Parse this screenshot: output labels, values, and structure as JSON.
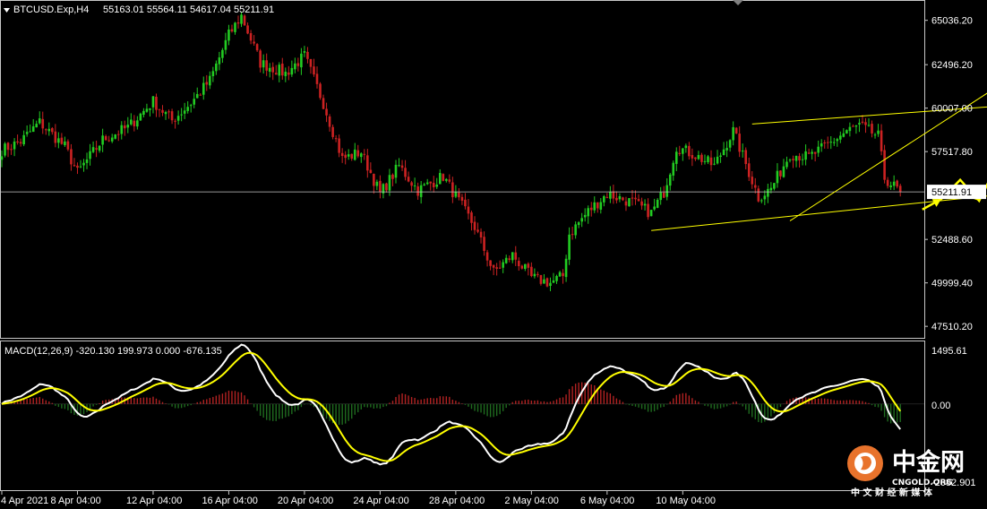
{
  "symbol_header": {
    "symbol": "BTCUSD.Exp,H4",
    "ohlc": "55163.01 55564.11 54617.04 55211.91"
  },
  "price_axis": {
    "ticks": [
      "65036.20",
      "62496.20",
      "60007.00",
      "57517.80",
      "55211.91",
      "52488.60",
      "49999.40",
      "47510.20"
    ],
    "current_price": "55211.91"
  },
  "macd_panel": {
    "label": "MACD(12,26,9) -320.130 199.973 0.000 -676.135",
    "ticks": [
      "1495.61",
      "0.00",
      "-2082.901"
    ]
  },
  "time_axis": {
    "ticks": [
      "4 Apr 2021",
      "8 Apr 04:00",
      "12 Apr 04:00",
      "16 Apr 04:00",
      "20 Apr 04:00",
      "24 Apr 04:00",
      "28 Apr 04:00",
      "2 May 04:00",
      "6 May 04:00",
      "10 May 04:00"
    ]
  },
  "watermark": {
    "brand_cn": "中金网",
    "brand_en": "CNGOLD.ORG",
    "tagline_cn": "中 文 财 经 新 媒 体"
  },
  "colors": {
    "background": "#000000",
    "bull_candle": "#22cc22",
    "bear_candle": "#cc2222",
    "macd_line": "#ffffff",
    "signal_line": "#ffff00",
    "hist_pos": "#b22222",
    "hist_neg": "#1f6b1f",
    "trendline": "#ffff00",
    "grid": "#c8c8c8"
  },
  "chart_data": [
    {
      "type": "candlestick",
      "title": "BTCUSD.Exp,H4",
      "ylim": [
        46800,
        66200
      ],
      "x_ticks": [
        "4 Apr 2021",
        "8 Apr 04:00",
        "12 Apr 04:00",
        "16 Apr 04:00",
        "20 Apr 04:00",
        "24 Apr 04:00",
        "28 Apr 04:00",
        "2 May 04:00",
        "6 May 04:00",
        "10 May 04:00"
      ],
      "anchors": {
        "bars_per_day": 6,
        "days": 38,
        "path": [
          [
            0,
            57600
          ],
          [
            6,
            58100
          ],
          [
            12,
            59200
          ],
          [
            20,
            57800
          ],
          [
            24,
            56300
          ],
          [
            32,
            58200
          ],
          [
            40,
            58900
          ],
          [
            48,
            60400
          ],
          [
            54,
            59300
          ],
          [
            60,
            60300
          ],
          [
            66,
            61600
          ],
          [
            72,
            64200
          ],
          [
            76,
            65300
          ],
          [
            82,
            62600
          ],
          [
            90,
            62000
          ],
          [
            96,
            63000
          ],
          [
            102,
            60300
          ],
          [
            108,
            57100
          ],
          [
            114,
            57500
          ],
          [
            120,
            55100
          ],
          [
            126,
            56700
          ],
          [
            132,
            55300
          ],
          [
            140,
            56100
          ],
          [
            150,
            53200
          ],
          [
            156,
            50600
          ],
          [
            162,
            51600
          ],
          [
            168,
            50300
          ],
          [
            174,
            50000
          ],
          [
            178,
            50400
          ],
          [
            180,
            52800
          ],
          [
            186,
            54100
          ],
          [
            192,
            55100
          ],
          [
            200,
            54600
          ],
          [
            206,
            54000
          ],
          [
            210,
            55200
          ],
          [
            214,
            57800
          ],
          [
            220,
            57300
          ],
          [
            226,
            56700
          ],
          [
            232,
            58700
          ],
          [
            236,
            56800
          ],
          [
            240,
            54900
          ],
          [
            244,
            55400
          ],
          [
            250,
            57400
          ],
          [
            256,
            57200
          ],
          [
            262,
            57900
          ],
          [
            268,
            58700
          ],
          [
            272,
            59000
          ],
          [
            278,
            58400
          ],
          [
            280,
            56000
          ],
          [
            285,
            55211.91
          ]
        ]
      },
      "trendlines": [
        {
          "name": "upper-channel",
          "from": [
            [
              238,
              59100
            ]
          ],
          "to": [
            [
              330,
              60300
            ]
          ]
        },
        {
          "name": "lower-channel",
          "from": [
            [
              206,
              53000
            ]
          ],
          "to": [
            [
              330,
              55300
            ]
          ]
        },
        {
          "name": "rising-line",
          "from": [
            [
              250,
              53550
            ]
          ],
          "to": [
            [
              330,
              62900
            ]
          ]
        }
      ],
      "projection": [
        [
          292,
          54200
        ],
        [
          298,
          54800
        ],
        [
          304,
          55900
        ],
        [
          308,
          55100
        ],
        [
          310,
          54700
        ],
        [
          318,
          57600
        ]
      ],
      "current_price": 55211.91
    },
    {
      "type": "macd",
      "params": [
        12,
        26,
        9
      ],
      "values": {
        "macd": -320.13,
        "signal": 199.973,
        "zero": 0.0,
        "hist": -676.135
      },
      "ylim": [
        -2082.901,
        1495.61
      ]
    }
  ]
}
